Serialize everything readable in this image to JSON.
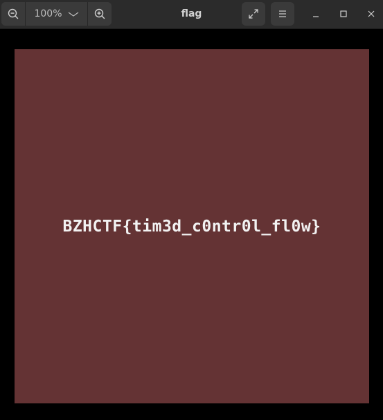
{
  "window": {
    "title": "flag"
  },
  "toolbar": {
    "zoom_level": "100%",
    "icons": {
      "zoom_out": "zoom-out-icon",
      "zoom_in": "zoom-in-icon",
      "zoom_dropdown": "chevron-down-icon",
      "fullscreen": "fullscreen-icon",
      "menu": "hamburger-menu-icon",
      "minimize": "minimize-icon",
      "maximize": "maximize-icon",
      "close": "close-icon"
    }
  },
  "image": {
    "text": "BZHCTF{tim3d_c0ntr0l_fl0w}",
    "background_color": "#643334",
    "text_color": "#f2f2f2"
  },
  "colors": {
    "headerbar": "#2b2b2b",
    "button": "#3a3a3a",
    "canvas": "#000000"
  }
}
